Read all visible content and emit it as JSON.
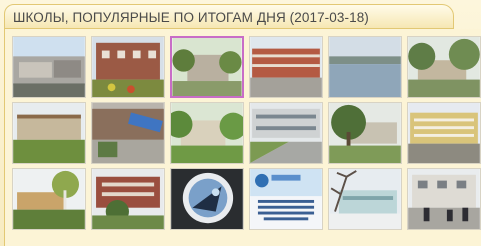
{
  "widget": {
    "title": "ШКОЛЫ, ПОПУЛЯРНЫЕ ПО ИТОГАМ ДНЯ (2017-03-18)"
  },
  "thumbnails": [
    {
      "row": 1,
      "col": 1,
      "subject": "school-building-blue-sky"
    },
    {
      "row": 1,
      "col": 2,
      "subject": "red-brick-school-flowerbed"
    },
    {
      "row": 1,
      "col": 3,
      "subject": "school-with-trees-purple-frame"
    },
    {
      "row": 1,
      "col": 4,
      "subject": "red-school-building-street"
    },
    {
      "row": 1,
      "col": 5,
      "subject": "lake-landscape"
    },
    {
      "row": 1,
      "col": 6,
      "subject": "school-behind-trees"
    },
    {
      "row": 2,
      "col": 1,
      "subject": "school-building-lawn"
    },
    {
      "row": 2,
      "col": 2,
      "subject": "school-entrance-blue-sign"
    },
    {
      "row": 2,
      "col": 3,
      "subject": "school-with-green-trees"
    },
    {
      "row": 2,
      "col": 4,
      "subject": "white-school-building-path"
    },
    {
      "row": 2,
      "col": 5,
      "subject": "school-behind-large-tree"
    },
    {
      "row": 2,
      "col": 6,
      "subject": "yellow-school-building"
    },
    {
      "row": 3,
      "col": 1,
      "subject": "school-with-birch-tree"
    },
    {
      "row": 3,
      "col": 2,
      "subject": "brick-school-bushes"
    },
    {
      "row": 3,
      "col": 3,
      "subject": "school-emblem-badge"
    },
    {
      "row": 3,
      "col": 4,
      "subject": "school-poster-banner"
    },
    {
      "row": 3,
      "col": 5,
      "subject": "school-winter-tree"
    },
    {
      "row": 3,
      "col": 6,
      "subject": "school-building-students"
    }
  ]
}
